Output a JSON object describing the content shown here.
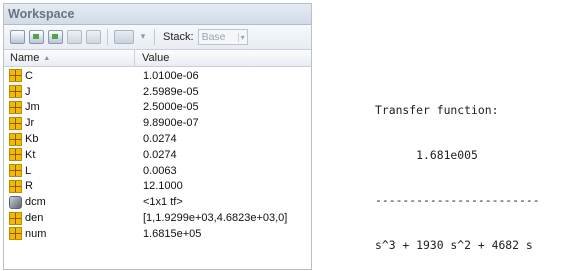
{
  "workspace": {
    "title": "Workspace",
    "toolbar": {
      "icons": [
        "new-variable-icon",
        "import-data-icon",
        "save-workspace-icon",
        "print-icon",
        "delete-icon",
        "plot-selector-icon",
        "dropdown-arrow-icon"
      ],
      "stack_label": "Stack:",
      "stack_value": "Base",
      "stack_arrow": "▾",
      "dropdown_arrow": "▾"
    },
    "columns": {
      "name": "Name",
      "name_sort": "▲",
      "value": "Value"
    },
    "variables": [
      {
        "name": "C",
        "value": "1.0100e-06",
        "icon": "matrix-icon"
      },
      {
        "name": "J",
        "value": "2.5989e-05",
        "icon": "matrix-icon"
      },
      {
        "name": "Jm",
        "value": "2.5000e-05",
        "icon": "matrix-icon"
      },
      {
        "name": "Jr",
        "value": "9.8900e-07",
        "icon": "matrix-icon"
      },
      {
        "name": "Kb",
        "value": "0.0274",
        "icon": "matrix-icon"
      },
      {
        "name": "Kt",
        "value": "0.0274",
        "icon": "matrix-icon"
      },
      {
        "name": "L",
        "value": "0.0063",
        "icon": "matrix-icon"
      },
      {
        "name": "R",
        "value": "12.1000",
        "icon": "matrix-icon"
      },
      {
        "name": "dcm",
        "value": "<1x1 tf>",
        "icon": "object-icon"
      },
      {
        "name": "den",
        "value": "[1,1.9299e+03,4.6823e+03,0]",
        "icon": "matrix-icon"
      },
      {
        "name": "num",
        "value": "1.6815e+05",
        "icon": "matrix-icon"
      }
    ],
    "colors": {
      "title_bg": "#d9e1ec",
      "matrix_icon": "#f3b800"
    }
  },
  "transfer_function": {
    "header": "Transfer function:",
    "numerator": "      1.681e005",
    "divider": "------------------------",
    "denominator": "s^3 + 1930 s^2 + 4682 s"
  }
}
